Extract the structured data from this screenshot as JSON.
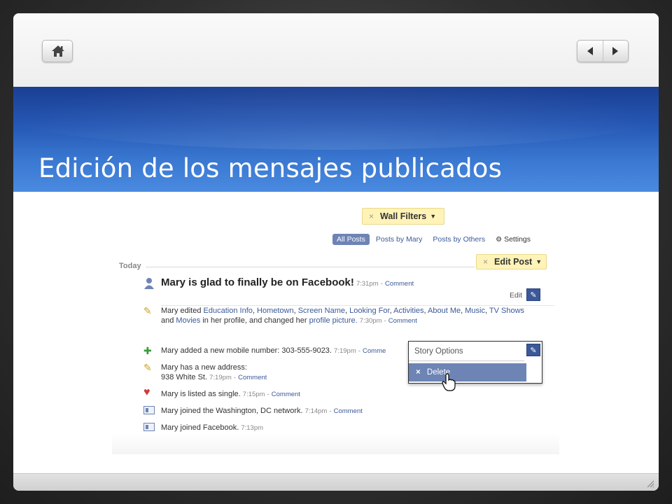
{
  "slide": {
    "title": "Edición de los mensajes publicados",
    "nav": {
      "home_icon": "home-icon",
      "prev_icon": "left-arrow-icon",
      "next_icon": "right-arrow-icon"
    }
  },
  "colors": {
    "title_band": "#2456b3",
    "fb_blue": "#3b5998",
    "pill_yellow": "#fff3b8",
    "menu_highlight": "#6d84b4"
  },
  "fb": {
    "wall_filters": {
      "x": "×",
      "label": "Wall Filters",
      "caret": "▼"
    },
    "filters": {
      "all": "All Posts",
      "by_mary": "Posts by Mary",
      "by_others": "Posts by Others",
      "settings": "Settings"
    },
    "today": "Today",
    "edit_post": {
      "x": "×",
      "label": "Edit Post",
      "caret": "▼"
    },
    "edit_link": "Edit",
    "headline": {
      "text": "Mary is glad to finally be on Facebook!",
      "time": "7:31pm",
      "dash": "-",
      "comment": "Comment"
    },
    "profile_edit": {
      "prefix": "Mary edited",
      "links": [
        "Education Info",
        "Hometown",
        "Screen Name",
        "Looking For",
        "Activities",
        "About Me",
        "Music",
        "TV Shows",
        "Movies"
      ],
      "and": "and",
      "mid": "in her profile, and changed her",
      "pic": "profile picture.",
      "time": "7:30pm",
      "comment": "Comment"
    },
    "mobile": {
      "text": "Mary added a new mobile number: 303-555-9023.",
      "time": "7:19pm",
      "comment": "Comme"
    },
    "address": {
      "line1": "Mary has a new address:",
      "line2": "938 White St.",
      "time": "7:19pm",
      "comment": "Comment"
    },
    "single": {
      "text": "Mary is listed as single.",
      "time": "7:15pm",
      "comment": "Comment"
    },
    "network": {
      "text": "Mary joined the Washington, DC network.",
      "time": "7:14pm",
      "comment": "Comment"
    },
    "joined": {
      "text": "Mary joined Facebook.",
      "time": "7:13pm"
    },
    "story_menu": {
      "options": "Story Options",
      "delete_x": "×",
      "delete": "Delete"
    }
  }
}
